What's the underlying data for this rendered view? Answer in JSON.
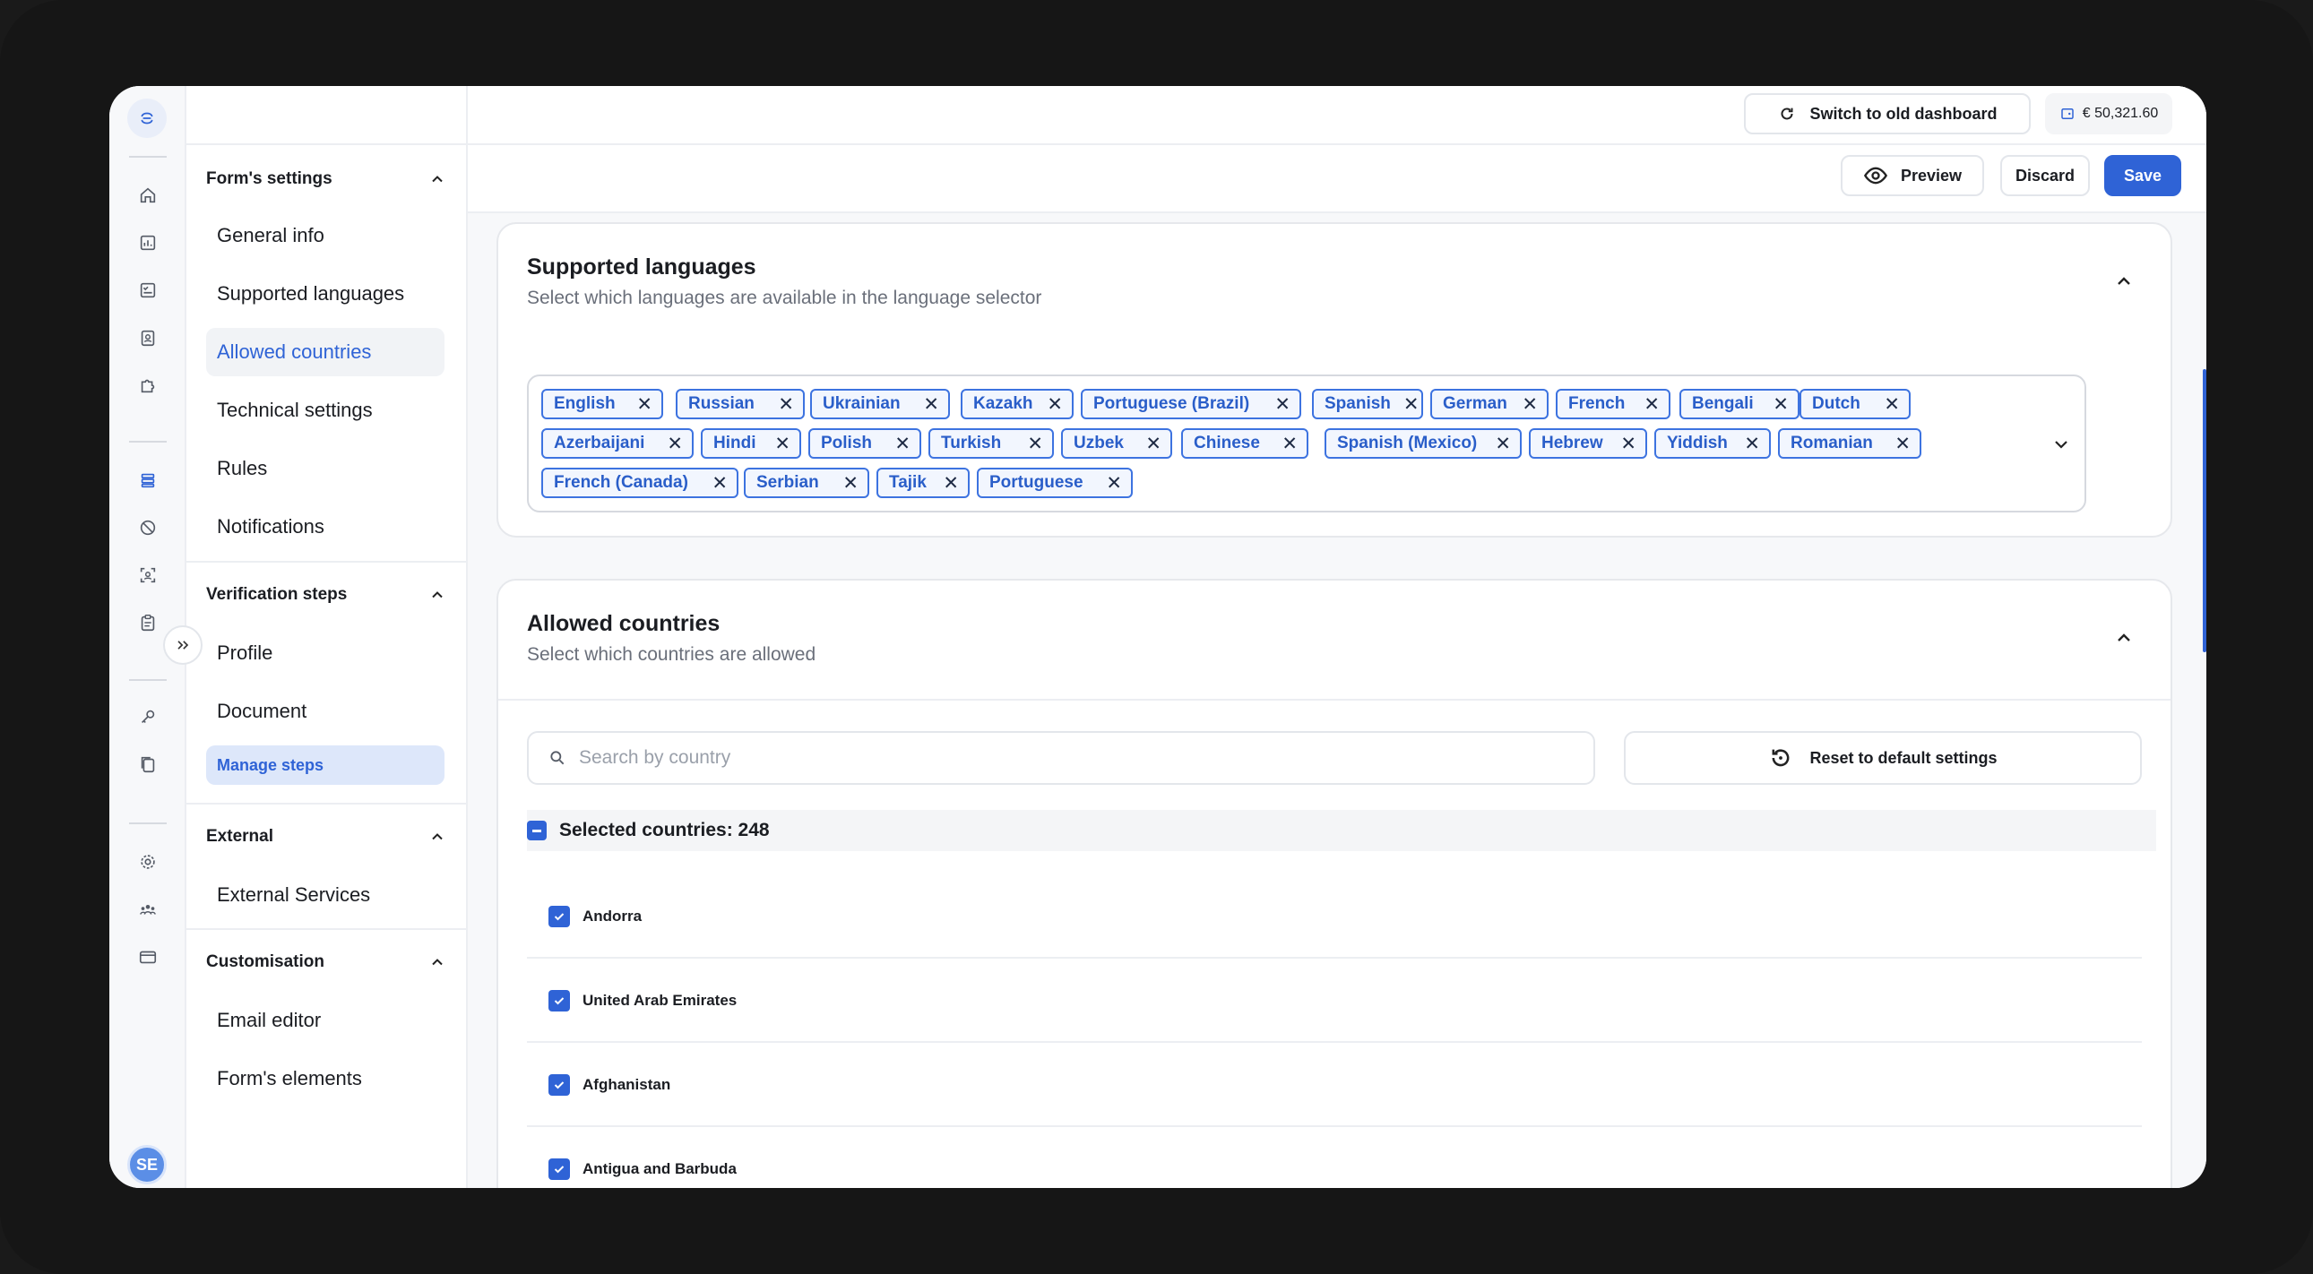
{
  "topbar": {
    "switch_label": "Switch to old dashboard",
    "balance": "€ 50,321.60"
  },
  "actions": {
    "preview": "Preview",
    "discard": "Discard",
    "save": "Save"
  },
  "user": {
    "initials": "SE"
  },
  "sidebar": {
    "groups": [
      {
        "title": "Form's settings",
        "items": [
          "General info",
          "Supported languages",
          "Allowed countries",
          "Technical settings",
          "Rules",
          "Notifications"
        ]
      },
      {
        "title": "Verification steps",
        "items": [
          "Profile",
          "Document",
          "Manage steps"
        ]
      },
      {
        "title": "External",
        "items": [
          "External Services"
        ]
      },
      {
        "title": "Customisation",
        "items": [
          "Email editor",
          "Form's elements"
        ]
      }
    ]
  },
  "languages": {
    "title": "Supported languages",
    "subtitle": "Select which languages are available in the language selector",
    "tags": [
      "English",
      "Russian",
      "Ukrainian",
      "Kazakh",
      "Portuguese (Brazil)",
      "Spanish",
      "German",
      "French",
      "Bengali",
      "Dutch",
      "Azerbaijani",
      "Hindi",
      "Polish",
      "Turkish",
      "Uzbek",
      "Chinese",
      "Spanish (Mexico)",
      "Hebrew",
      "Yiddish",
      "Romanian",
      "French (Canada)",
      "Serbian",
      "Tajik",
      "Portuguese"
    ]
  },
  "countries": {
    "title": "Allowed countries",
    "subtitle": "Select which countries are allowed",
    "search_placeholder": "Search by country",
    "reset_label": "Reset to default settings",
    "selected_label": "Selected countries: 248",
    "list": [
      "Andorra",
      "United Arab Emirates",
      "Afghanistan",
      "Antigua and Barbuda"
    ]
  },
  "colors": {
    "accent": "#2f63d6",
    "tag_bg": "#f2f6fe"
  },
  "icons": [
    "logo-icon",
    "home-icon",
    "chart-icon",
    "checklist-icon",
    "id-card-icon",
    "puzzle-icon",
    "stack-icon",
    "block-icon",
    "face-scan-icon",
    "clipboard-icon",
    "key-icon",
    "documents-icon",
    "gear-icon",
    "team-icon",
    "card-icon"
  ]
}
